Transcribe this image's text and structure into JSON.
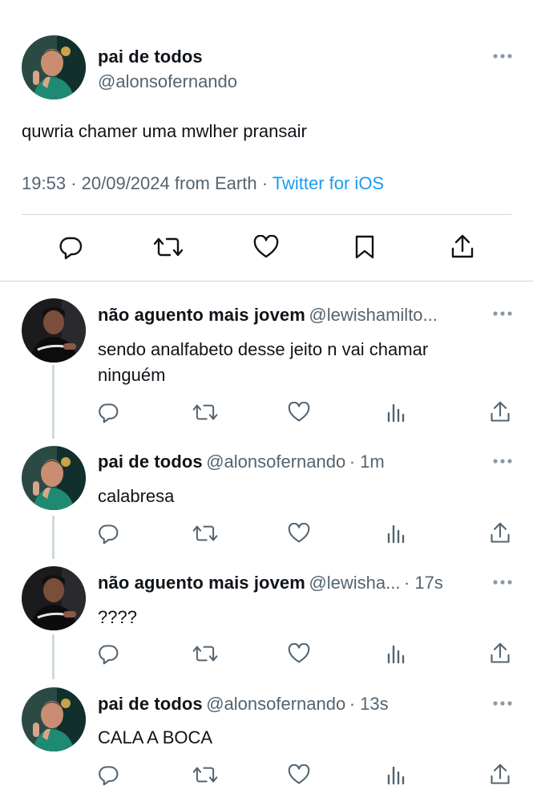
{
  "main_tweet": {
    "display_name": "pai de todos",
    "handle": "@alonsofernando",
    "text": "quwria chamer uma mwlher pransair",
    "time": "19:53",
    "date": "20/09/2024",
    "location": "from Earth",
    "source": "Twitter for iOS",
    "separator": "·"
  },
  "replies": [
    {
      "display_name": "não aguento mais jovem",
      "handle": "@lewishamilto...",
      "time": "",
      "text_line1": "sendo analfabeto desse jeito n vai chamar",
      "text_line2": "ninguém"
    },
    {
      "display_name": "pai de todos",
      "handle": "@alonsofernando",
      "time": "· 1m",
      "text_line1": "calabresa",
      "text_line2": ""
    },
    {
      "display_name": "não aguento mais jovem",
      "handle": "@lewisha...",
      "time": "· 17s",
      "text_line1": "????",
      "text_line2": ""
    },
    {
      "display_name": "pai de todos",
      "handle": "@alonsofernando",
      "time": "· 13s",
      "text_line1": "CALA A BOCA",
      "text_line2": ""
    }
  ],
  "colors": {
    "link": "#1d9bf0",
    "secondary_text": "#536471",
    "divider": "#cfd9de",
    "icon": "#536471",
    "main_icon": "#0f1419"
  },
  "icons": {
    "reply": "speech-bubble-icon",
    "retweet": "retweet-arrows-icon",
    "like": "heart-icon",
    "bookmark": "bookmark-icon",
    "share": "share-upload-icon",
    "views": "bar-chart-icon",
    "more": "three-dots-icon"
  }
}
